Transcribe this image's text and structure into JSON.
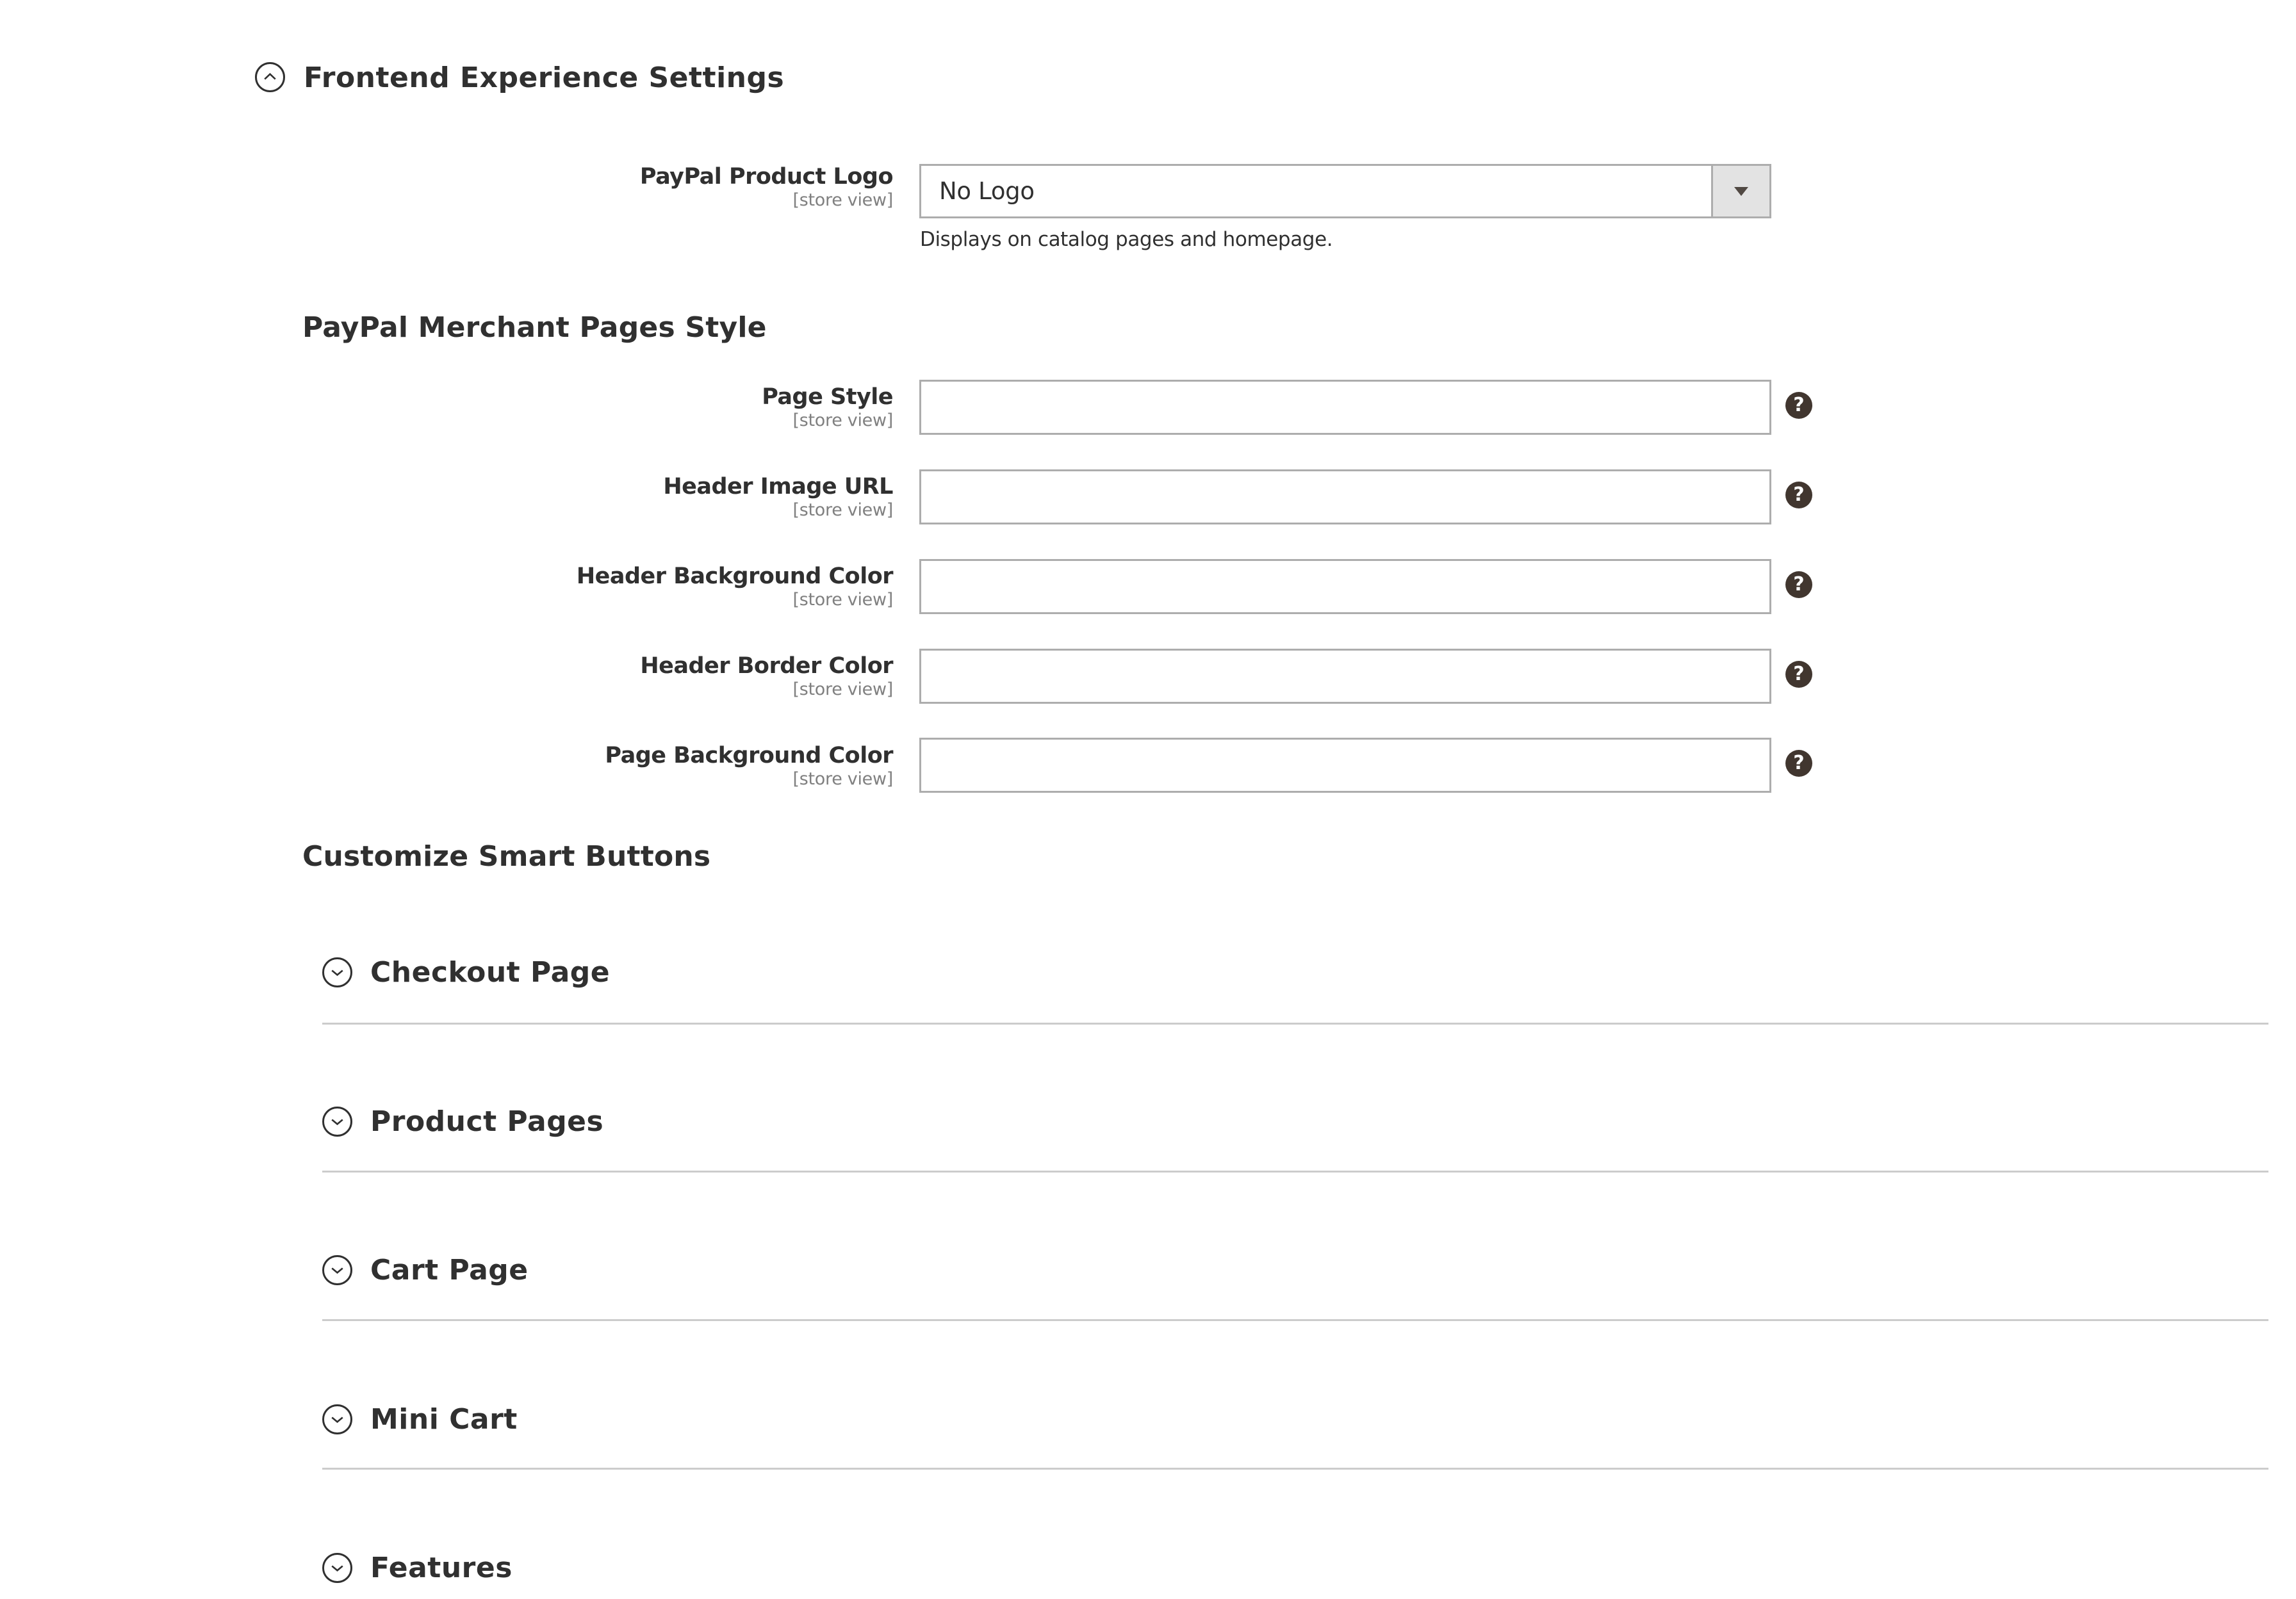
{
  "frontend_section": {
    "title": "Frontend Experience Settings",
    "state": "expanded",
    "icon": "chevron-up-circle-icon"
  },
  "product_logo": {
    "label": "PayPal Product Logo",
    "scope": "[store view]",
    "selected": "No Logo",
    "hint": "Displays on catalog pages and homepage.",
    "icon": "dropdown-arrow-icon"
  },
  "merchant_pages": {
    "title": "PayPal Merchant Pages Style",
    "fields": [
      {
        "label": "Page Style",
        "scope": "[store view]",
        "value": "",
        "help": "?"
      },
      {
        "label": "Header Image URL",
        "scope": "[store view]",
        "value": "",
        "help": "?"
      },
      {
        "label": "Header Background Color",
        "scope": "[store view]",
        "value": "",
        "help": "?"
      },
      {
        "label": "Header Border Color",
        "scope": "[store view]",
        "value": "",
        "help": "?"
      },
      {
        "label": "Page Background Color",
        "scope": "[store view]",
        "value": "",
        "help": "?"
      }
    ]
  },
  "smart_buttons": {
    "title": "Customize Smart Buttons",
    "groups": [
      {
        "label": "Checkout Page",
        "state": "collapsed",
        "icon": "chevron-down-circle-icon"
      },
      {
        "label": "Product Pages",
        "state": "collapsed",
        "icon": "chevron-down-circle-icon"
      },
      {
        "label": "Cart Page",
        "state": "collapsed",
        "icon": "chevron-down-circle-icon"
      },
      {
        "label": "Mini Cart",
        "state": "collapsed",
        "icon": "chevron-down-circle-icon"
      },
      {
        "label": "Features",
        "state": "collapsed",
        "icon": "chevron-down-circle-icon"
      }
    ]
  },
  "colors": {
    "text": "#303030",
    "scope_text": "#808080",
    "input_border": "#adadad",
    "select_arrow_bg": "#e3e3e3",
    "help_icon_bg": "#41362f",
    "divider": "#cccccc"
  }
}
